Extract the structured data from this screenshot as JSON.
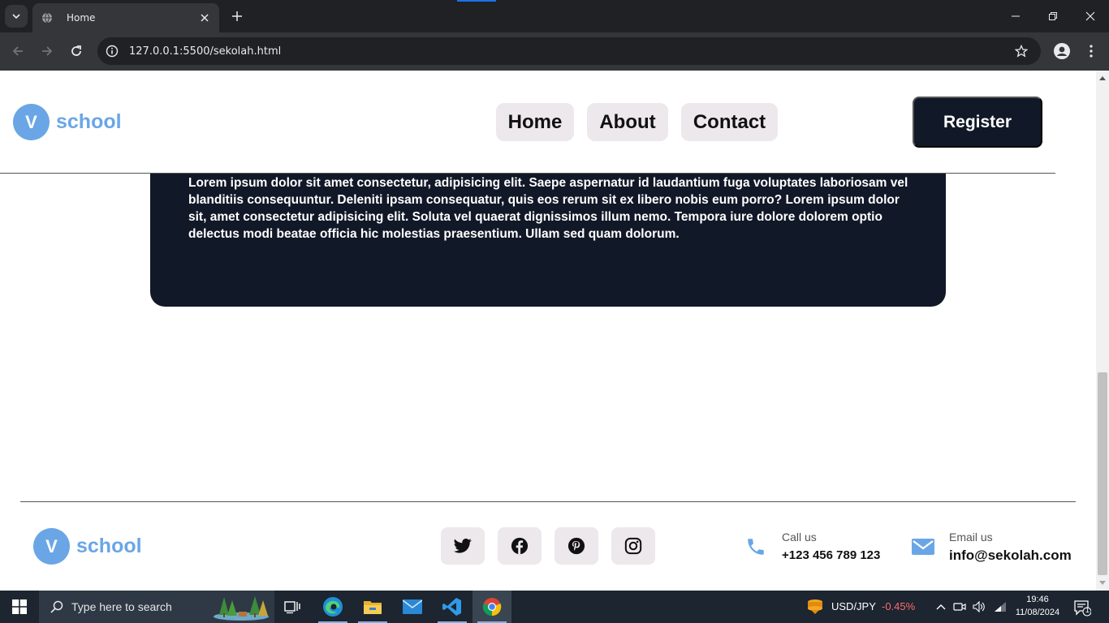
{
  "browser": {
    "tab_title": "Home",
    "url": "127.0.0.1:5500/sekolah.html"
  },
  "header": {
    "logo_letter": "V",
    "logo_text": "school",
    "nav": [
      {
        "label": "Home"
      },
      {
        "label": "About"
      },
      {
        "label": "Contact"
      }
    ],
    "register_label": "Register"
  },
  "content": {
    "paragraph": "Lorem ipsum dolor sit amet consectetur, adipisicing elit. Saepe aspernatur id laudantium fuga voluptates laboriosam vel blanditiis consequuntur. Deleniti ipsam consequatur, quis eos rerum sit ex libero nobis eum porro? Lorem ipsum dolor sit, amet consectetur adipisicing elit. Soluta vel quaerat dignissimos illum nemo. Tempora iure dolore dolorem optio delectus modi beatae officia hic molestias praesentium. Ullam sed quam dolorum."
  },
  "footer": {
    "logo_letter": "V",
    "logo_text": "school",
    "social": [
      "twitter-icon",
      "facebook-icon",
      "pinterest-icon",
      "instagram-icon"
    ],
    "call_label": "Call us",
    "call_value": "+123 456 789 123",
    "email_label": "Email us",
    "email_value": "info@sekolah.com"
  },
  "taskbar": {
    "search_placeholder": "Type here to search",
    "ticker_symbol": "USD/JPY",
    "ticker_change": "-0.45%",
    "time": "19:46",
    "date": "11/08/2024",
    "notification_count": "1"
  },
  "colors": {
    "accent": "#6aa6e6",
    "dark": "#111827",
    "pill": "#ede8ec",
    "ticker_negative": "#ff6b6b"
  }
}
